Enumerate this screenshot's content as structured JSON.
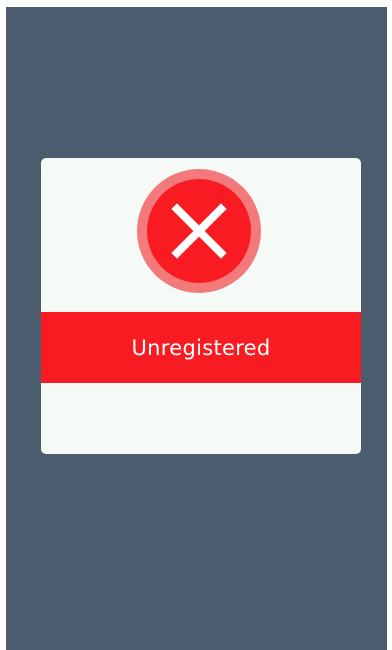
{
  "screen": {
    "background_color": "#4b5c6e"
  },
  "dialog": {
    "background_color": "#f6faf7",
    "status_icon": "close-icon",
    "status_color": "#f81c22",
    "status_ring_color": "#f37a7a",
    "status_label": "Unregistered"
  }
}
